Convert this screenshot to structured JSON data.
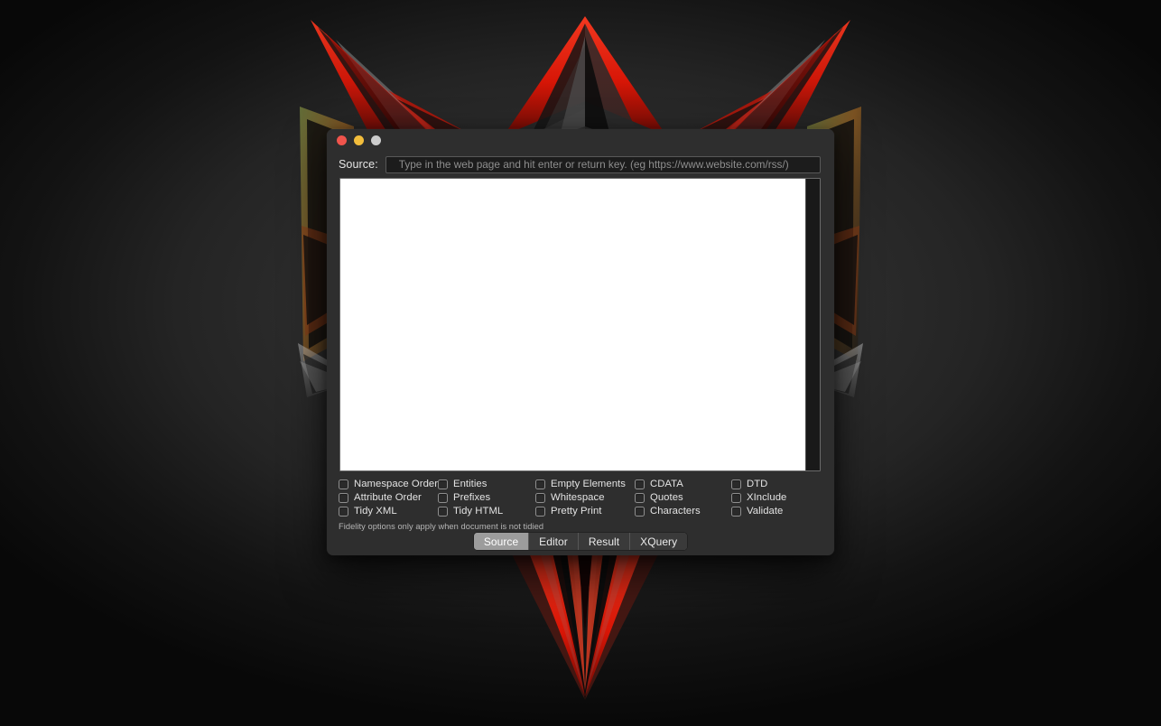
{
  "desktop": {
    "wallpaper_name": "red-geometric-spikes-wallpaper",
    "background_color": "#2e2e2e",
    "accent_red": "#f01e10",
    "accent_gray": "#9a9a9a"
  },
  "window": {
    "title": "",
    "traffic_lights": [
      {
        "name": "close-button",
        "label": "Close",
        "color": "#f0544c"
      },
      {
        "name": "minimize-button",
        "label": "Minimize",
        "color": "#f2bd3c"
      },
      {
        "name": "zoom-button",
        "label": "Zoom",
        "color": "#cccccc"
      }
    ]
  },
  "source": {
    "label": "Source:",
    "value": "",
    "placeholder": "Type in the web page and hit enter or return key. (eg https://www.website.com/rss/)"
  },
  "document": {
    "content": "",
    "background_color": "#ffffff"
  },
  "options": {
    "items": [
      {
        "label": "Namespace Order",
        "checked": false
      },
      {
        "label": "Entities",
        "checked": false
      },
      {
        "label": "Empty Elements",
        "checked": false
      },
      {
        "label": "CDATA",
        "checked": false
      },
      {
        "label": "DTD",
        "checked": false
      },
      {
        "label": "Attribute Order",
        "checked": false
      },
      {
        "label": "Prefixes",
        "checked": false
      },
      {
        "label": "Whitespace",
        "checked": false
      },
      {
        "label": "Quotes",
        "checked": false
      },
      {
        "label": "XInclude",
        "checked": false
      },
      {
        "label": "Tidy XML",
        "checked": false
      },
      {
        "label": "Tidy HTML",
        "checked": false
      },
      {
        "label": "Pretty Print",
        "checked": false
      },
      {
        "label": "Characters",
        "checked": false
      },
      {
        "label": "Validate",
        "checked": false
      }
    ],
    "note": "Fidelity options only apply when document is not tidied"
  },
  "tabs": {
    "selected": "Source",
    "items": [
      {
        "label": "Source"
      },
      {
        "label": "Editor"
      },
      {
        "label": "Result"
      },
      {
        "label": "XQuery"
      }
    ]
  }
}
